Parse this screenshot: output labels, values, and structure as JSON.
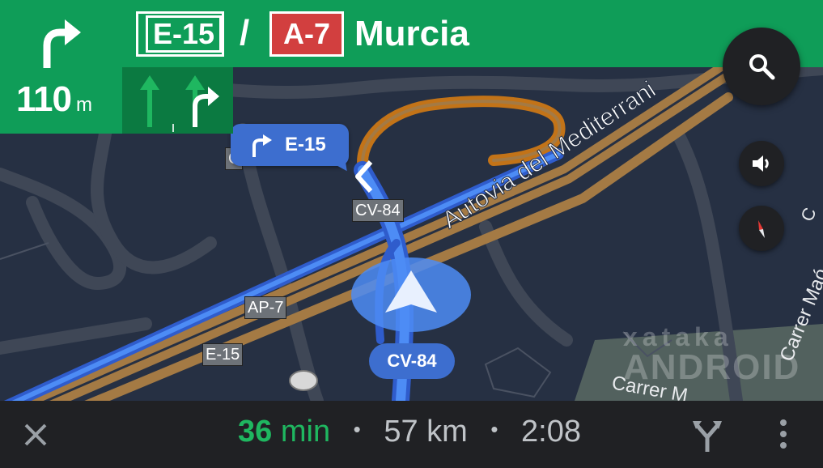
{
  "guidance": {
    "turn_icon": "turn-right-arrow-icon",
    "distance_value": "110",
    "distance_unit": "m",
    "lanes": [
      "straight-arrow-icon",
      "straight-arrow-icon",
      "turn-right-arrow-icon"
    ],
    "route_shield_1": "E-15",
    "separator": "/",
    "route_shield_2": "A-7",
    "destination": "Murcia"
  },
  "map": {
    "callout_label": "E-15",
    "callout_icon": "turn-right-arrow-icon",
    "current_road": "CV-84",
    "street_autovia": "Autovia del Mediterrani",
    "street_carrer_1": "Carrer Maó",
    "street_carrer_2": "Carrer M",
    "signs": {
      "cv84": "CV-84",
      "ap7": "AP-7",
      "e15": "E-15",
      "c_partial": "C",
      "c_right": "C"
    },
    "watermark_top": "xataka",
    "watermark_bottom": "ANDROID"
  },
  "controls": {
    "search_icon": "search-icon",
    "sound_icon": "volume-icon",
    "compass_icon": "compass-icon"
  },
  "trip": {
    "minutes": "36",
    "minutes_unit": "min",
    "distance": "57 km",
    "arrival": "2:08",
    "separator": "•"
  },
  "colors": {
    "banner": "#0f9d58",
    "route": "#3d6ecf",
    "highway": "#a47a44",
    "map_bg": "#263043",
    "a7_shield": "#d23f3f"
  }
}
